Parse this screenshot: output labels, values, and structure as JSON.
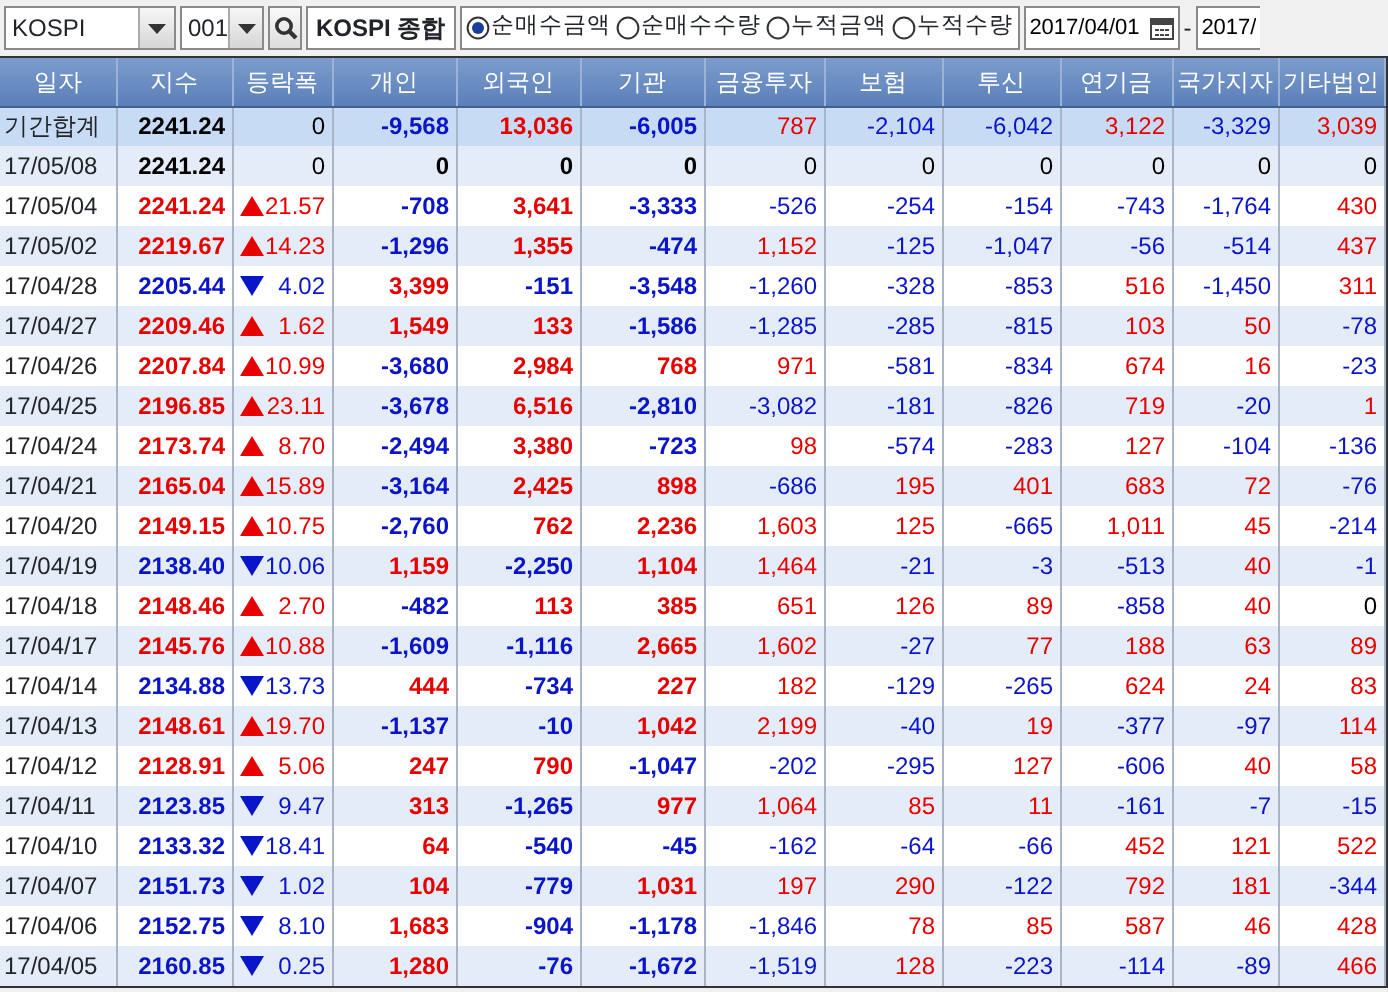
{
  "toolbar": {
    "market": "KOSPI",
    "code": "001",
    "index_name": "KOSPI 종합",
    "options": [
      {
        "label": "순매수금액",
        "selected": true
      },
      {
        "label": "순매수수량",
        "selected": false
      },
      {
        "label": "누적금액",
        "selected": false
      },
      {
        "label": "누적수량",
        "selected": false
      }
    ],
    "date_from": "2017/04/01",
    "separator": "-",
    "date_to": "2017/"
  },
  "table": {
    "columns": [
      "일자",
      "지수",
      "등락폭",
      "개인",
      "외국인",
      "기관",
      "금융투자",
      "보험",
      "투신",
      "연기금",
      "국가지자",
      "기타법인"
    ],
    "rows": [
      {
        "kind": "total",
        "date": "기간합계",
        "index": {
          "text": "2241.24",
          "color": "#000000"
        },
        "change": {
          "kind": "flat",
          "text": "0",
          "color": "#000000"
        },
        "values": [
          {
            "text": "-9,568",
            "color": "#0a14c8"
          },
          {
            "text": "13,036",
            "color": "#e60000"
          },
          {
            "text": "-6,005",
            "color": "#0a14c8"
          },
          {
            "text": "787",
            "color": "#e60000"
          },
          {
            "text": "-2,104",
            "color": "#0a14c8"
          },
          {
            "text": "-6,042",
            "color": "#0a14c8"
          },
          {
            "text": "3,122",
            "color": "#e60000"
          },
          {
            "text": "-3,329",
            "color": "#0a14c8"
          },
          {
            "text": "3,039",
            "color": "#e60000"
          }
        ]
      },
      {
        "kind": "day",
        "date": "17/05/08",
        "index": {
          "text": "2241.24",
          "color": "#000000"
        },
        "change": {
          "kind": "flat",
          "text": "0",
          "color": "#000000"
        },
        "values": [
          {
            "text": "0",
            "color": "#000000"
          },
          {
            "text": "0",
            "color": "#000000"
          },
          {
            "text": "0",
            "color": "#000000"
          },
          {
            "text": "0",
            "color": "#000000"
          },
          {
            "text": "0",
            "color": "#000000"
          },
          {
            "text": "0",
            "color": "#000000"
          },
          {
            "text": "0",
            "color": "#000000"
          },
          {
            "text": "0",
            "color": "#000000"
          },
          {
            "text": "0",
            "color": "#000000"
          }
        ]
      },
      {
        "kind": "day",
        "date": "17/05/04",
        "index": {
          "text": "2241.24",
          "color": "#e60000"
        },
        "change": {
          "kind": "up",
          "text": "21.57",
          "color": "#e60000"
        },
        "values": [
          {
            "text": "-708",
            "color": "#0a14c8"
          },
          {
            "text": "3,641",
            "color": "#e60000"
          },
          {
            "text": "-3,333",
            "color": "#0a14c8"
          },
          {
            "text": "-526",
            "color": "#0a14c8"
          },
          {
            "text": "-254",
            "color": "#0a14c8"
          },
          {
            "text": "-154",
            "color": "#0a14c8"
          },
          {
            "text": "-743",
            "color": "#0a14c8"
          },
          {
            "text": "-1,764",
            "color": "#0a14c8"
          },
          {
            "text": "430",
            "color": "#e60000"
          }
        ]
      },
      {
        "kind": "day",
        "date": "17/05/02",
        "index": {
          "text": "2219.67",
          "color": "#e60000"
        },
        "change": {
          "kind": "up",
          "text": "14.23",
          "color": "#e60000"
        },
        "values": [
          {
            "text": "-1,296",
            "color": "#0a14c8"
          },
          {
            "text": "1,355",
            "color": "#e60000"
          },
          {
            "text": "-474",
            "color": "#0a14c8"
          },
          {
            "text": "1,152",
            "color": "#e60000"
          },
          {
            "text": "-125",
            "color": "#0a14c8"
          },
          {
            "text": "-1,047",
            "color": "#0a14c8"
          },
          {
            "text": "-56",
            "color": "#0a14c8"
          },
          {
            "text": "-514",
            "color": "#0a14c8"
          },
          {
            "text": "437",
            "color": "#e60000"
          }
        ]
      },
      {
        "kind": "day",
        "date": "17/04/28",
        "index": {
          "text": "2205.44",
          "color": "#0a14c8"
        },
        "change": {
          "kind": "down",
          "text": "4.02",
          "color": "#0a14c8"
        },
        "values": [
          {
            "text": "3,399",
            "color": "#e60000"
          },
          {
            "text": "-151",
            "color": "#0a14c8"
          },
          {
            "text": "-3,548",
            "color": "#0a14c8"
          },
          {
            "text": "-1,260",
            "color": "#0a14c8"
          },
          {
            "text": "-328",
            "color": "#0a14c8"
          },
          {
            "text": "-853",
            "color": "#0a14c8"
          },
          {
            "text": "516",
            "color": "#e60000"
          },
          {
            "text": "-1,450",
            "color": "#0a14c8"
          },
          {
            "text": "311",
            "color": "#e60000"
          }
        ]
      },
      {
        "kind": "day",
        "date": "17/04/27",
        "index": {
          "text": "2209.46",
          "color": "#e60000"
        },
        "change": {
          "kind": "up",
          "text": "1.62",
          "color": "#e60000"
        },
        "values": [
          {
            "text": "1,549",
            "color": "#e60000"
          },
          {
            "text": "133",
            "color": "#e60000"
          },
          {
            "text": "-1,586",
            "color": "#0a14c8"
          },
          {
            "text": "-1,285",
            "color": "#0a14c8"
          },
          {
            "text": "-285",
            "color": "#0a14c8"
          },
          {
            "text": "-815",
            "color": "#0a14c8"
          },
          {
            "text": "103",
            "color": "#e60000"
          },
          {
            "text": "50",
            "color": "#e60000"
          },
          {
            "text": "-78",
            "color": "#0a14c8"
          }
        ]
      },
      {
        "kind": "day",
        "date": "17/04/26",
        "index": {
          "text": "2207.84",
          "color": "#e60000"
        },
        "change": {
          "kind": "up",
          "text": "10.99",
          "color": "#e60000"
        },
        "values": [
          {
            "text": "-3,680",
            "color": "#0a14c8"
          },
          {
            "text": "2,984",
            "color": "#e60000"
          },
          {
            "text": "768",
            "color": "#e60000"
          },
          {
            "text": "971",
            "color": "#e60000"
          },
          {
            "text": "-581",
            "color": "#0a14c8"
          },
          {
            "text": "-834",
            "color": "#0a14c8"
          },
          {
            "text": "674",
            "color": "#e60000"
          },
          {
            "text": "16",
            "color": "#e60000"
          },
          {
            "text": "-23",
            "color": "#0a14c8"
          }
        ]
      },
      {
        "kind": "day",
        "date": "17/04/25",
        "index": {
          "text": "2196.85",
          "color": "#e60000"
        },
        "change": {
          "kind": "up",
          "text": "23.11",
          "color": "#e60000"
        },
        "values": [
          {
            "text": "-3,678",
            "color": "#0a14c8"
          },
          {
            "text": "6,516",
            "color": "#e60000"
          },
          {
            "text": "-2,810",
            "color": "#0a14c8"
          },
          {
            "text": "-3,082",
            "color": "#0a14c8"
          },
          {
            "text": "-181",
            "color": "#0a14c8"
          },
          {
            "text": "-826",
            "color": "#0a14c8"
          },
          {
            "text": "719",
            "color": "#e60000"
          },
          {
            "text": "-20",
            "color": "#0a14c8"
          },
          {
            "text": "1",
            "color": "#e60000"
          }
        ]
      },
      {
        "kind": "day",
        "date": "17/04/24",
        "index": {
          "text": "2173.74",
          "color": "#e60000"
        },
        "change": {
          "kind": "up",
          "text": "8.70",
          "color": "#e60000"
        },
        "values": [
          {
            "text": "-2,494",
            "color": "#0a14c8"
          },
          {
            "text": "3,380",
            "color": "#e60000"
          },
          {
            "text": "-723",
            "color": "#0a14c8"
          },
          {
            "text": "98",
            "color": "#e60000"
          },
          {
            "text": "-574",
            "color": "#0a14c8"
          },
          {
            "text": "-283",
            "color": "#0a14c8"
          },
          {
            "text": "127",
            "color": "#e60000"
          },
          {
            "text": "-104",
            "color": "#0a14c8"
          },
          {
            "text": "-136",
            "color": "#0a14c8"
          }
        ]
      },
      {
        "kind": "day",
        "date": "17/04/21",
        "index": {
          "text": "2165.04",
          "color": "#e60000"
        },
        "change": {
          "kind": "up",
          "text": "15.89",
          "color": "#e60000"
        },
        "values": [
          {
            "text": "-3,164",
            "color": "#0a14c8"
          },
          {
            "text": "2,425",
            "color": "#e60000"
          },
          {
            "text": "898",
            "color": "#e60000"
          },
          {
            "text": "-686",
            "color": "#0a14c8"
          },
          {
            "text": "195",
            "color": "#e60000"
          },
          {
            "text": "401",
            "color": "#e60000"
          },
          {
            "text": "683",
            "color": "#e60000"
          },
          {
            "text": "72",
            "color": "#e60000"
          },
          {
            "text": "-76",
            "color": "#0a14c8"
          }
        ]
      },
      {
        "kind": "day",
        "date": "17/04/20",
        "index": {
          "text": "2149.15",
          "color": "#e60000"
        },
        "change": {
          "kind": "up",
          "text": "10.75",
          "color": "#e60000"
        },
        "values": [
          {
            "text": "-2,760",
            "color": "#0a14c8"
          },
          {
            "text": "762",
            "color": "#e60000"
          },
          {
            "text": "2,236",
            "color": "#e60000"
          },
          {
            "text": "1,603",
            "color": "#e60000"
          },
          {
            "text": "125",
            "color": "#e60000"
          },
          {
            "text": "-665",
            "color": "#0a14c8"
          },
          {
            "text": "1,011",
            "color": "#e60000"
          },
          {
            "text": "45",
            "color": "#e60000"
          },
          {
            "text": "-214",
            "color": "#0a14c8"
          }
        ]
      },
      {
        "kind": "day",
        "date": "17/04/19",
        "index": {
          "text": "2138.40",
          "color": "#0a14c8"
        },
        "change": {
          "kind": "down",
          "text": "10.06",
          "color": "#0a14c8"
        },
        "values": [
          {
            "text": "1,159",
            "color": "#e60000"
          },
          {
            "text": "-2,250",
            "color": "#0a14c8"
          },
          {
            "text": "1,104",
            "color": "#e60000"
          },
          {
            "text": "1,464",
            "color": "#e60000"
          },
          {
            "text": "-21",
            "color": "#0a14c8"
          },
          {
            "text": "-3",
            "color": "#0a14c8"
          },
          {
            "text": "-513",
            "color": "#0a14c8"
          },
          {
            "text": "40",
            "color": "#e60000"
          },
          {
            "text": "-1",
            "color": "#0a14c8"
          }
        ]
      },
      {
        "kind": "day",
        "date": "17/04/18",
        "index": {
          "text": "2148.46",
          "color": "#e60000"
        },
        "change": {
          "kind": "up",
          "text": "2.70",
          "color": "#e60000"
        },
        "values": [
          {
            "text": "-482",
            "color": "#0a14c8"
          },
          {
            "text": "113",
            "color": "#e60000"
          },
          {
            "text": "385",
            "color": "#e60000"
          },
          {
            "text": "651",
            "color": "#e60000"
          },
          {
            "text": "126",
            "color": "#e60000"
          },
          {
            "text": "89",
            "color": "#e60000"
          },
          {
            "text": "-858",
            "color": "#0a14c8"
          },
          {
            "text": "40",
            "color": "#e60000"
          },
          {
            "text": "0",
            "color": "#000000"
          }
        ]
      },
      {
        "kind": "day",
        "date": "17/04/17",
        "index": {
          "text": "2145.76",
          "color": "#e60000"
        },
        "change": {
          "kind": "up",
          "text": "10.88",
          "color": "#e60000"
        },
        "values": [
          {
            "text": "-1,609",
            "color": "#0a14c8"
          },
          {
            "text": "-1,116",
            "color": "#0a14c8"
          },
          {
            "text": "2,665",
            "color": "#e60000"
          },
          {
            "text": "1,602",
            "color": "#e60000"
          },
          {
            "text": "-27",
            "color": "#0a14c8"
          },
          {
            "text": "77",
            "color": "#e60000"
          },
          {
            "text": "188",
            "color": "#e60000"
          },
          {
            "text": "63",
            "color": "#e60000"
          },
          {
            "text": "89",
            "color": "#e60000"
          }
        ]
      },
      {
        "kind": "day",
        "date": "17/04/14",
        "index": {
          "text": "2134.88",
          "color": "#0a14c8"
        },
        "change": {
          "kind": "down",
          "text": "13.73",
          "color": "#0a14c8"
        },
        "values": [
          {
            "text": "444",
            "color": "#e60000"
          },
          {
            "text": "-734",
            "color": "#0a14c8"
          },
          {
            "text": "227",
            "color": "#e60000"
          },
          {
            "text": "182",
            "color": "#e60000"
          },
          {
            "text": "-129",
            "color": "#0a14c8"
          },
          {
            "text": "-265",
            "color": "#0a14c8"
          },
          {
            "text": "624",
            "color": "#e60000"
          },
          {
            "text": "24",
            "color": "#e60000"
          },
          {
            "text": "83",
            "color": "#e60000"
          }
        ]
      },
      {
        "kind": "day",
        "date": "17/04/13",
        "index": {
          "text": "2148.61",
          "color": "#e60000"
        },
        "change": {
          "kind": "up",
          "text": "19.70",
          "color": "#e60000"
        },
        "values": [
          {
            "text": "-1,137",
            "color": "#0a14c8"
          },
          {
            "text": "-10",
            "color": "#0a14c8"
          },
          {
            "text": "1,042",
            "color": "#e60000"
          },
          {
            "text": "2,199",
            "color": "#e60000"
          },
          {
            "text": "-40",
            "color": "#0a14c8"
          },
          {
            "text": "19",
            "color": "#e60000"
          },
          {
            "text": "-377",
            "color": "#0a14c8"
          },
          {
            "text": "-97",
            "color": "#0a14c8"
          },
          {
            "text": "114",
            "color": "#e60000"
          }
        ]
      },
      {
        "kind": "day",
        "date": "17/04/12",
        "index": {
          "text": "2128.91",
          "color": "#e60000"
        },
        "change": {
          "kind": "up",
          "text": "5.06",
          "color": "#e60000"
        },
        "values": [
          {
            "text": "247",
            "color": "#e60000"
          },
          {
            "text": "790",
            "color": "#e60000"
          },
          {
            "text": "-1,047",
            "color": "#0a14c8"
          },
          {
            "text": "-202",
            "color": "#0a14c8"
          },
          {
            "text": "-295",
            "color": "#0a14c8"
          },
          {
            "text": "127",
            "color": "#e60000"
          },
          {
            "text": "-606",
            "color": "#0a14c8"
          },
          {
            "text": "40",
            "color": "#e60000"
          },
          {
            "text": "58",
            "color": "#e60000"
          }
        ]
      },
      {
        "kind": "day",
        "date": "17/04/11",
        "index": {
          "text": "2123.85",
          "color": "#0a14c8"
        },
        "change": {
          "kind": "down",
          "text": "9.47",
          "color": "#0a14c8"
        },
        "values": [
          {
            "text": "313",
            "color": "#e60000"
          },
          {
            "text": "-1,265",
            "color": "#0a14c8"
          },
          {
            "text": "977",
            "color": "#e60000"
          },
          {
            "text": "1,064",
            "color": "#e60000"
          },
          {
            "text": "85",
            "color": "#e60000"
          },
          {
            "text": "11",
            "color": "#e60000"
          },
          {
            "text": "-161",
            "color": "#0a14c8"
          },
          {
            "text": "-7",
            "color": "#0a14c8"
          },
          {
            "text": "-15",
            "color": "#0a14c8"
          }
        ]
      },
      {
        "kind": "day",
        "date": "17/04/10",
        "index": {
          "text": "2133.32",
          "color": "#0a14c8"
        },
        "change": {
          "kind": "down",
          "text": "18.41",
          "color": "#0a14c8"
        },
        "values": [
          {
            "text": "64",
            "color": "#e60000"
          },
          {
            "text": "-540",
            "color": "#0a14c8"
          },
          {
            "text": "-45",
            "color": "#0a14c8"
          },
          {
            "text": "-162",
            "color": "#0a14c8"
          },
          {
            "text": "-64",
            "color": "#0a14c8"
          },
          {
            "text": "-66",
            "color": "#0a14c8"
          },
          {
            "text": "452",
            "color": "#e60000"
          },
          {
            "text": "121",
            "color": "#e60000"
          },
          {
            "text": "522",
            "color": "#e60000"
          }
        ]
      },
      {
        "kind": "day",
        "date": "17/04/07",
        "index": {
          "text": "2151.73",
          "color": "#0a14c8"
        },
        "change": {
          "kind": "down",
          "text": "1.02",
          "color": "#0a14c8"
        },
        "values": [
          {
            "text": "104",
            "color": "#e60000"
          },
          {
            "text": "-779",
            "color": "#0a14c8"
          },
          {
            "text": "1,031",
            "color": "#e60000"
          },
          {
            "text": "197",
            "color": "#e60000"
          },
          {
            "text": "290",
            "color": "#e60000"
          },
          {
            "text": "-122",
            "color": "#0a14c8"
          },
          {
            "text": "792",
            "color": "#e60000"
          },
          {
            "text": "181",
            "color": "#e60000"
          },
          {
            "text": "-344",
            "color": "#0a14c8"
          }
        ]
      },
      {
        "kind": "day",
        "date": "17/04/06",
        "index": {
          "text": "2152.75",
          "color": "#0a14c8"
        },
        "change": {
          "kind": "down",
          "text": "8.10",
          "color": "#0a14c8"
        },
        "values": [
          {
            "text": "1,683",
            "color": "#e60000"
          },
          {
            "text": "-904",
            "color": "#0a14c8"
          },
          {
            "text": "-1,178",
            "color": "#0a14c8"
          },
          {
            "text": "-1,846",
            "color": "#0a14c8"
          },
          {
            "text": "78",
            "color": "#e60000"
          },
          {
            "text": "85",
            "color": "#e60000"
          },
          {
            "text": "587",
            "color": "#e60000"
          },
          {
            "text": "46",
            "color": "#e60000"
          },
          {
            "text": "428",
            "color": "#e60000"
          }
        ]
      },
      {
        "kind": "day",
        "date": "17/04/05",
        "index": {
          "text": "2160.85",
          "color": "#0a14c8"
        },
        "change": {
          "kind": "down",
          "text": "0.25",
          "color": "#0a14c8"
        },
        "values": [
          {
            "text": "1,280",
            "color": "#e60000"
          },
          {
            "text": "-76",
            "color": "#0a14c8"
          },
          {
            "text": "-1,672",
            "color": "#0a14c8"
          },
          {
            "text": "-1,519",
            "color": "#0a14c8"
          },
          {
            "text": "128",
            "color": "#e60000"
          },
          {
            "text": "-223",
            "color": "#0a14c8"
          },
          {
            "text": "-114",
            "color": "#0a14c8"
          },
          {
            "text": "-89",
            "color": "#0a14c8"
          },
          {
            "text": "466",
            "color": "#e60000"
          }
        ]
      }
    ]
  }
}
